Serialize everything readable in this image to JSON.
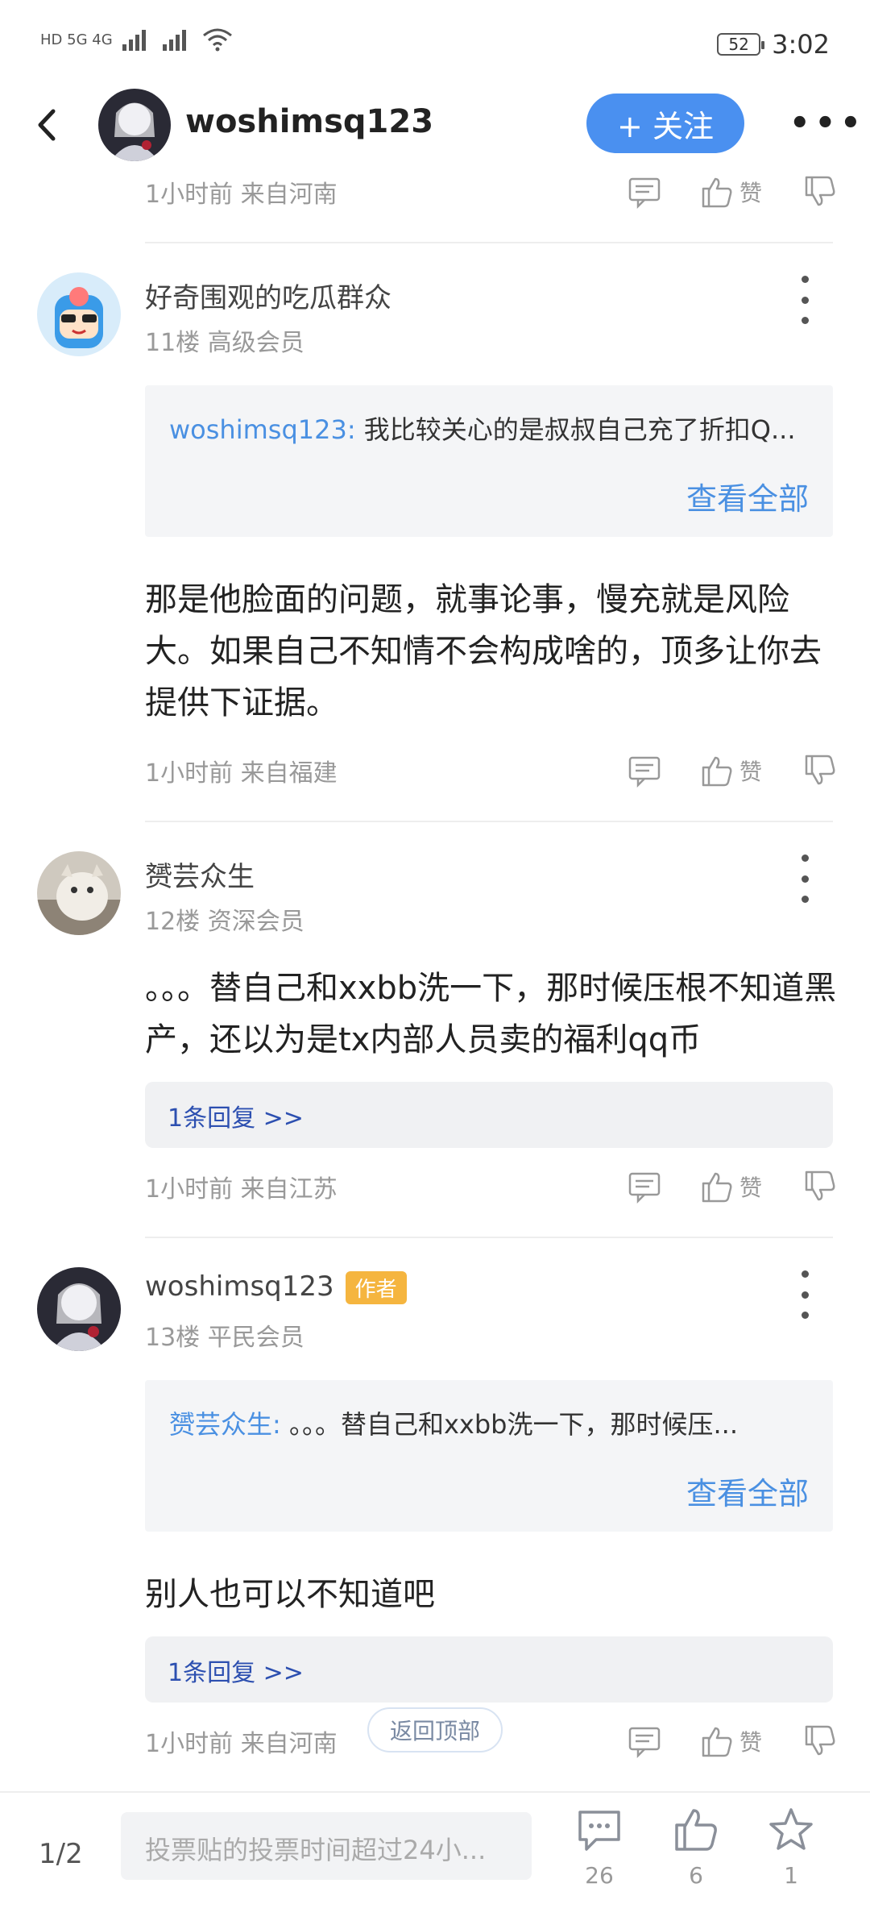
{
  "status_bar": {
    "network": "HD 5G 4G",
    "battery": "52",
    "time": "3:02"
  },
  "header": {
    "username": "woshimsq123",
    "follow_label": "+ 关注"
  },
  "top_meta": {
    "meta": "1小时前 来自河南",
    "like_label": "赞"
  },
  "posts": [
    {
      "name": "好奇围观的吃瓜群众",
      "level": "11楼 高级会员",
      "quote_name": "woshimsq123:",
      "quote_text": " 我比较关心的是叔叔自己充了折扣Q...",
      "quote_more": "查看全部",
      "content": "那是他脸面的问题，就事论事，慢充就是风险大。如果自己不知情不会构成啥的，顶多让你去提供下证据。",
      "meta": "1小时前 来自福建",
      "like_label": "赞"
    },
    {
      "name": "赟芸众生",
      "level": "12楼 资深会员",
      "content": "。。。替自己和xxbb洗一下，那时候压根不知道黑产，还以为是tx内部人员卖的福利qq币",
      "reply": "1条回复 >>",
      "meta": "1小时前 来自江苏",
      "like_label": "赞"
    },
    {
      "name": "woshimsq123",
      "badge": "作者",
      "level": "13楼 平民会员",
      "quote_name": "赟芸众生:",
      "quote_text": " 。。。替自己和xxbb洗一下，那时候压...",
      "quote_more": "查看全部",
      "content": "别人也可以不知道吧",
      "reply": "1条回复 >>",
      "meta": "1小时前 来自河南",
      "like_label": "赞"
    }
  ],
  "back_to_top": "返回顶部",
  "bottom_bar": {
    "page": "1/2",
    "input_placeholder": "投票贴的投票时间超过24小...",
    "comments": "26",
    "likes": "6",
    "favorites": "1"
  },
  "colors": {
    "accent": "#4a90f0",
    "link": "#4a90e2",
    "author_badge": "#f5b53f",
    "reply_link": "#2c4fb0"
  }
}
